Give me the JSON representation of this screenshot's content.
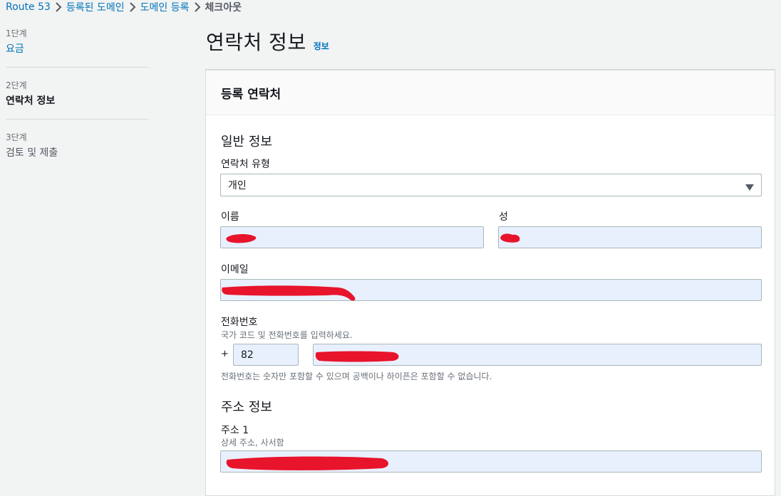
{
  "breadcrumb": [
    {
      "label": "Route 53"
    },
    {
      "label": "등록된 도메인"
    },
    {
      "label": "도메인 등록"
    },
    {
      "label": "체크아웃"
    }
  ],
  "steps": [
    {
      "num": "1단계",
      "label": "요금"
    },
    {
      "num": "2단계",
      "label": "연락처 정보"
    },
    {
      "num": "3단계",
      "label": "검토 및 제출"
    }
  ],
  "page": {
    "title": "연락처 정보",
    "info_link": "정보"
  },
  "panel": {
    "header": "등록 연락처"
  },
  "general": {
    "title": "일반 정보",
    "contact_type_label": "연락처 유형",
    "contact_type_value": "개인",
    "first_name_label": "이름",
    "last_name_label": "성",
    "email_label": "이메일",
    "phone_label": "전화번호",
    "phone_desc": "국가 코드 및 전화번호를 입력하세요.",
    "phone_plus": "+",
    "country_code": "82",
    "phone_hint": "전화번호는 숫자만 포함할 수 있으며 공백이나 하이픈은 포함할 수 없습니다."
  },
  "address": {
    "title": "주소 정보",
    "address1_label": "주소 1",
    "address1_desc": "상세 주소, 사서함"
  },
  "colors": {
    "link": "#0073bb",
    "input_autofill": "#e8f0fe",
    "redaction": "#e8142b"
  }
}
